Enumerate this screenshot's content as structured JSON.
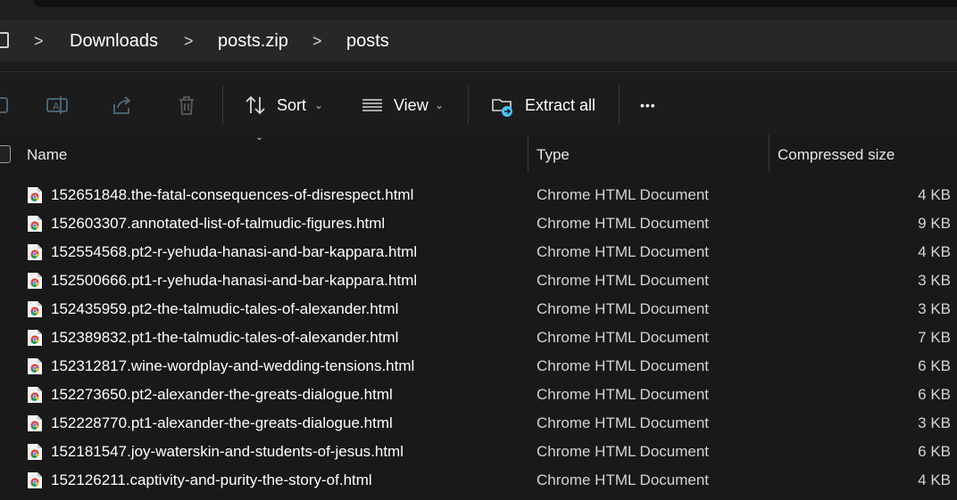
{
  "breadcrumb": {
    "items": [
      "Downloads",
      "posts.zip",
      "posts"
    ],
    "separator": ">"
  },
  "toolbar": {
    "sort_label": "Sort",
    "view_label": "View",
    "extract_label": "Extract all",
    "more_label": "•••",
    "caret": "⌄"
  },
  "columns": {
    "name": "Name",
    "type": "Type",
    "size": "Compressed size"
  },
  "files": [
    {
      "name": "152651848.the-fatal-consequences-of-disrespect.html",
      "type": "Chrome HTML Document",
      "size": "4 KB"
    },
    {
      "name": "152603307.annotated-list-of-talmudic-figures.html",
      "type": "Chrome HTML Document",
      "size": "9 KB"
    },
    {
      "name": "152554568.pt2-r-yehuda-hanasi-and-bar-kappara.html",
      "type": "Chrome HTML Document",
      "size": "4 KB"
    },
    {
      "name": "152500666.pt1-r-yehuda-hanasi-and-bar-kappara.html",
      "type": "Chrome HTML Document",
      "size": "3 KB"
    },
    {
      "name": "152435959.pt2-the-talmudic-tales-of-alexander.html",
      "type": "Chrome HTML Document",
      "size": "3 KB"
    },
    {
      "name": "152389832.pt1-the-talmudic-tales-of-alexander.html",
      "type": "Chrome HTML Document",
      "size": "7 KB"
    },
    {
      "name": "152312817.wine-wordplay-and-wedding-tensions.html",
      "type": "Chrome HTML Document",
      "size": "6 KB"
    },
    {
      "name": "152273650.pt2-alexander-the-greats-dialogue.html",
      "type": "Chrome HTML Document",
      "size": "6 KB"
    },
    {
      "name": "152228770.pt1-alexander-the-greats-dialogue.html",
      "type": "Chrome HTML Document",
      "size": "3 KB"
    },
    {
      "name": "152181547.joy-waterskin-and-students-of-jesus.html",
      "type": "Chrome HTML Document",
      "size": "6 KB"
    },
    {
      "name": "152126211.captivity-and-purity-the-story-of.html",
      "type": "Chrome HTML Document",
      "size": "4 KB"
    }
  ],
  "icons": {
    "file": "chrome-html-file-icon",
    "extract": "folder-extract-icon"
  },
  "colors": {
    "background": "#191919",
    "accent": "#4cc2ff"
  }
}
